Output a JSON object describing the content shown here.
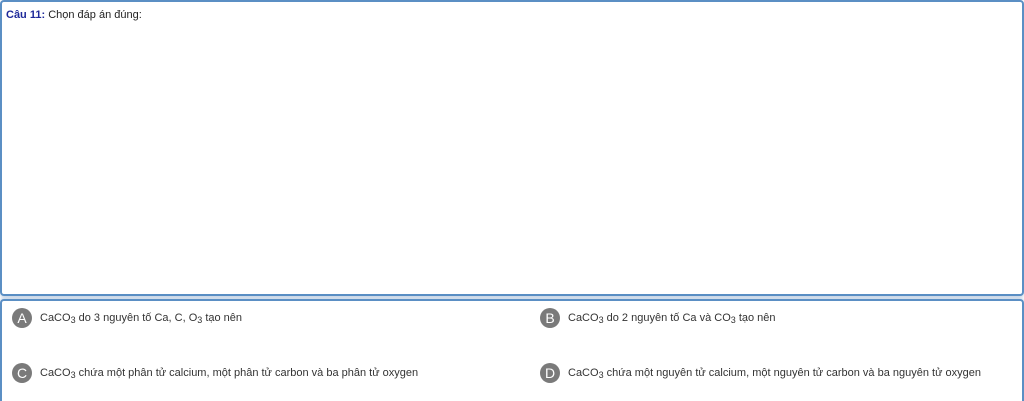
{
  "question": {
    "number": "Câu 11:",
    "prompt": " Chọn đáp án đúng:"
  },
  "options": [
    {
      "letter": "A",
      "parts": [
        "CaCO",
        "3",
        " do 3 nguyên tố Ca, C, O",
        "3",
        " tạo nên"
      ]
    },
    {
      "letter": "B",
      "parts": [
        "CaCO",
        "3",
        " do 2 nguyên tố Ca và CO",
        "3",
        " tạo nên"
      ]
    },
    {
      "letter": "C",
      "parts": [
        "CaCO",
        "3",
        " chứa một phân tử calcium, một phân tử carbon và ba phân tử oxygen"
      ]
    },
    {
      "letter": "D",
      "parts": [
        "CaCO",
        "3",
        " chứa một nguyên tử calcium, một nguyên tử carbon và ba nguyên tử oxygen"
      ]
    }
  ],
  "colors": {
    "border": "#5b8fc4",
    "question_number": "#1f2a9a",
    "badge": "#7a7a7a"
  }
}
